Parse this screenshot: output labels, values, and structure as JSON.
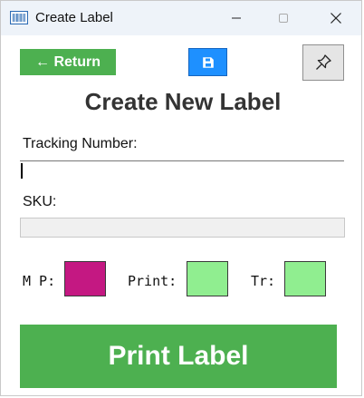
{
  "window": {
    "title": "Create Label",
    "app_icon": "barcode-icon",
    "controls": {
      "minimize": "minimize-icon",
      "maximize": "maximize-icon",
      "close": "close-icon"
    }
  },
  "toolbar": {
    "return_label": "← Return",
    "save_icon": "save-icon",
    "pin_icon": "pin-icon"
  },
  "form": {
    "heading": "Create New Label",
    "tracking_label": "Tracking Number:",
    "tracking_value": "",
    "sku_label": "SKU:",
    "sku_value": ""
  },
  "status": {
    "mp_label": "M P:",
    "print_label": "Print:",
    "tr_label": "Tr:",
    "mp_color": "#c41882",
    "print_color": "#90ee90",
    "tr_color": "#90ee90"
  },
  "actions": {
    "print_label": "Print Label"
  },
  "colors": {
    "accent_green": "#4db050",
    "save_blue": "#1e90ff"
  }
}
